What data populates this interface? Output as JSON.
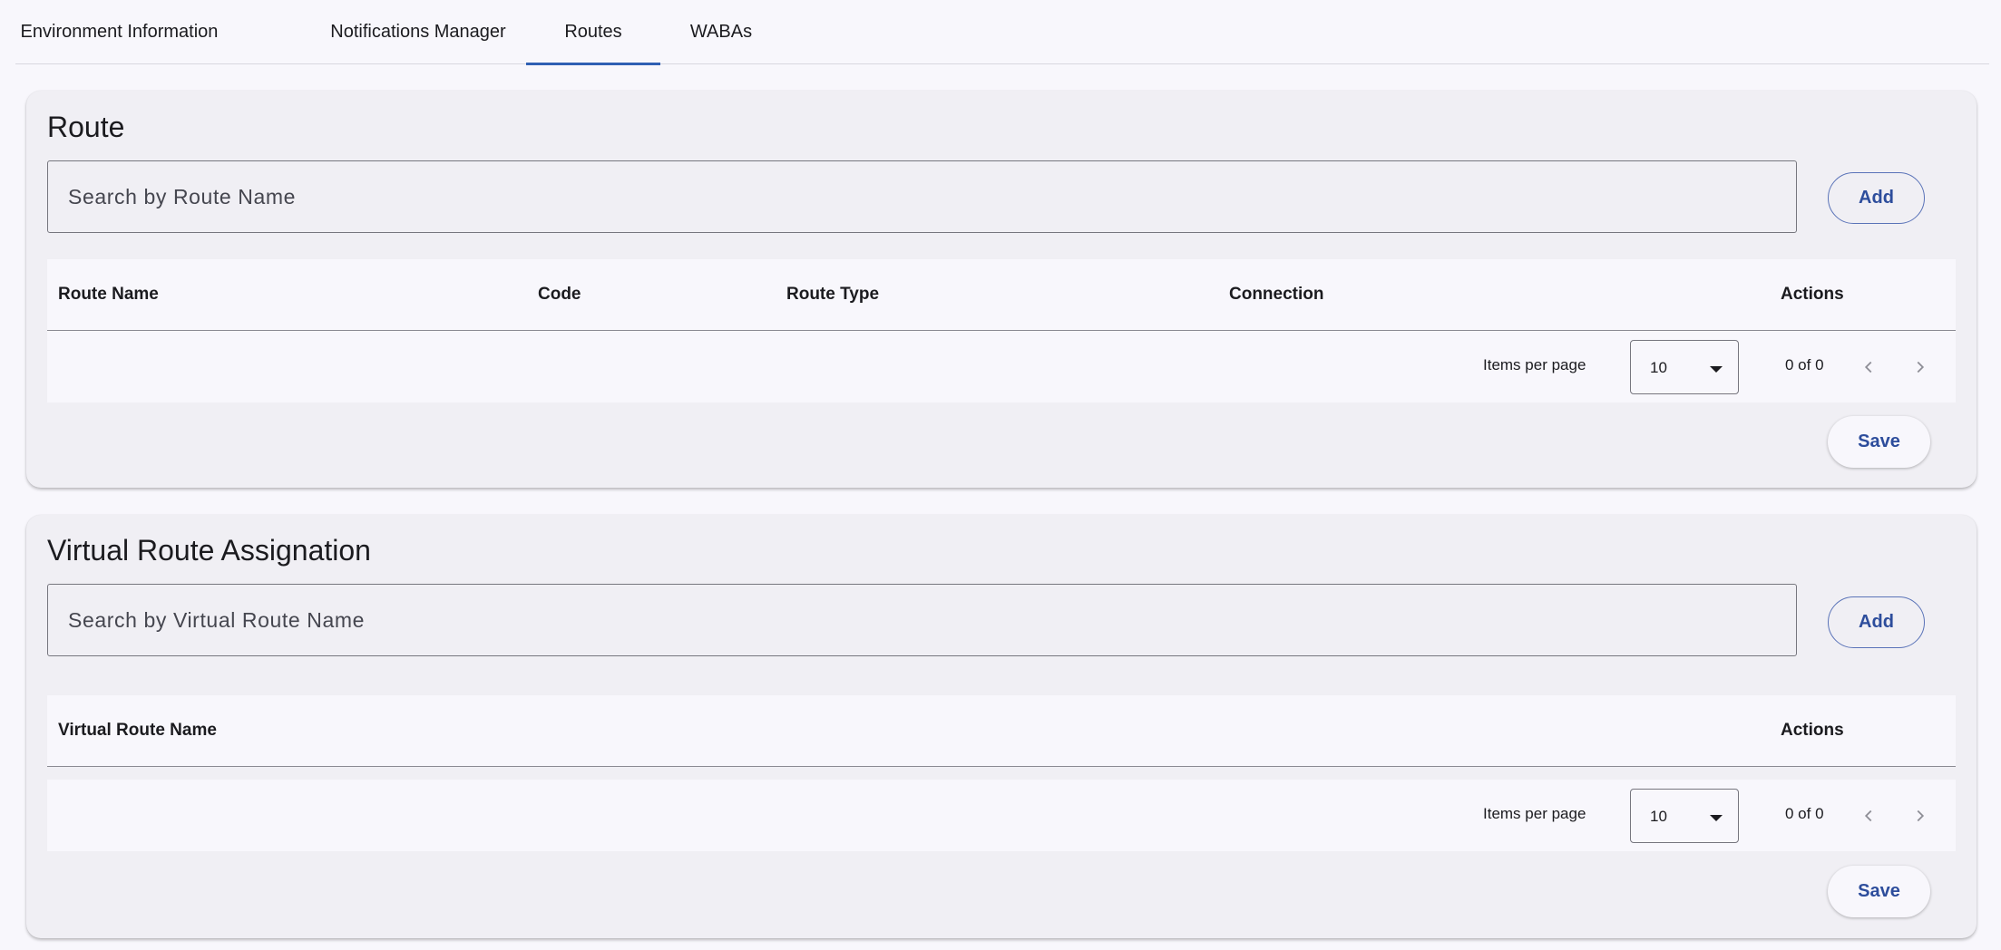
{
  "tabs": [
    {
      "label": "Environment Information",
      "active": false
    },
    {
      "label": "Notifications Manager",
      "active": false
    },
    {
      "label": "Routes",
      "active": true
    },
    {
      "label": "WABAs",
      "active": false
    }
  ],
  "route_card": {
    "title": "Route",
    "search_placeholder": "Search by Route Name",
    "add_label": "Add",
    "columns": [
      "Route Name",
      "Code",
      "Route Type",
      "Connection",
      "Actions"
    ],
    "rows": [],
    "paginator": {
      "items_per_page_label": "Items per page",
      "page_size": "10",
      "range": "0 of 0"
    },
    "save_label": "Save"
  },
  "virtual_card": {
    "title": "Virtual Route Assignation",
    "search_placeholder": "Search by Virtual Route Name",
    "add_label": "Add",
    "columns": [
      "Virtual Route Name",
      "Actions"
    ],
    "rows": [],
    "paginator": {
      "items_per_page_label": "Items per page",
      "page_size": "10",
      "range": "0 of 0"
    },
    "save_label": "Save"
  },
  "icons": {
    "previous_page": "chevron-left-icon",
    "next_page": "chevron-right-icon",
    "dropdown": "caret-down-icon"
  },
  "colors": {
    "accent": "#2f5fb3",
    "button_text": "#2d4d9c",
    "page_background": "#f8f7fc",
    "card_background": "#f0eff4"
  }
}
